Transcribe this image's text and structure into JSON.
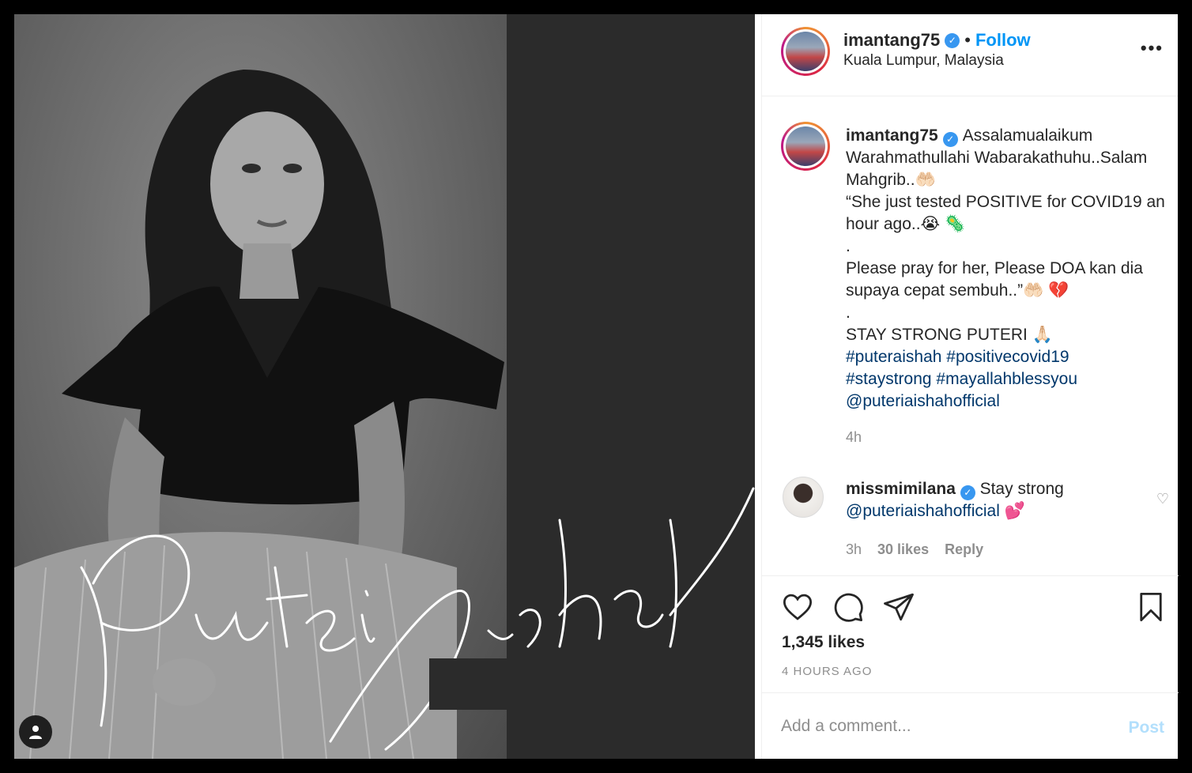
{
  "header": {
    "username": "imantang75",
    "separator": "•",
    "follow_label": "Follow",
    "location": "Kuala Lumpur, Malaysia",
    "more_label": "•••"
  },
  "photo": {
    "signature_text": "Puteri Aishah"
  },
  "caption": {
    "username": "imantang75",
    "line1": "Assalamualaikum Warahmathullahi Wabarakathuhu..Salam Mahgrib..🤲🏻",
    "line2": "“She just tested POSITIVE for COVID19 an hour ago..😭 🦠",
    "dot1": ".",
    "line3": "Please pray for her, Please DOA kan dia supaya cepat sembuh..”🤲🏻 💔",
    "dot2": ".",
    "line4": "STAY STRONG PUTERI 🙏🏻",
    "hashtags": [
      "#puteraishah",
      "#positivecovid19",
      "#staystrong",
      "#mayallahblessyou"
    ],
    "mention": "@puteriaishahofficial",
    "time": "4h"
  },
  "comment": {
    "username": "missmimilana",
    "text": "Stay strong",
    "mention": "@puteriaishahofficial",
    "emoji": "💕",
    "time": "3h",
    "likes": "30 likes",
    "reply": "Reply"
  },
  "actions": {
    "likes": "1,345 likes",
    "posted": "4 HOURS AGO"
  },
  "add_comment": {
    "placeholder": "Add a comment...",
    "post_label": "Post"
  },
  "colors": {
    "accent": "#0095f6",
    "hashtag": "#00376b",
    "muted": "#8e8e8e",
    "post_disabled": "#b2dffc"
  }
}
